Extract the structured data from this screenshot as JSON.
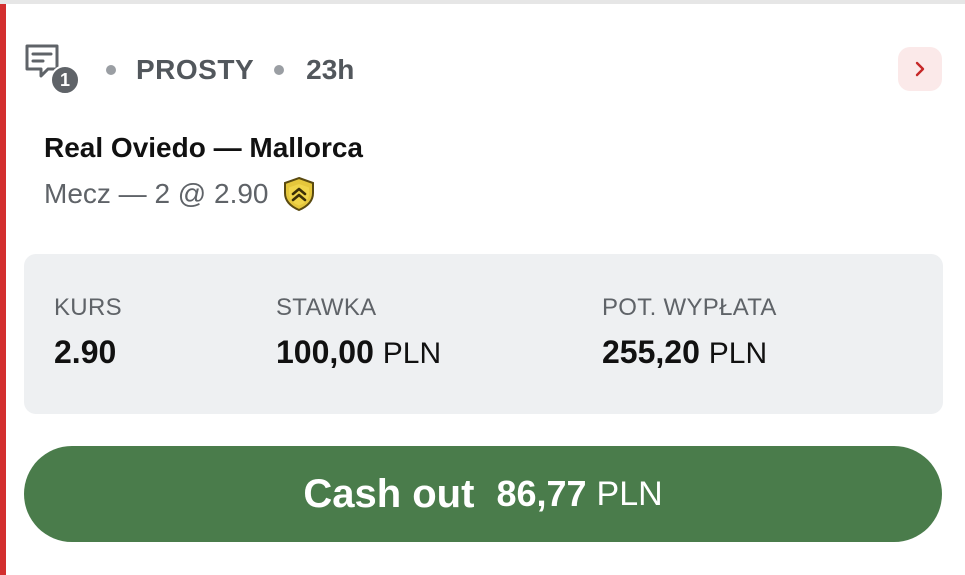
{
  "header": {
    "selection_count": "1",
    "bet_type": "PROSTY",
    "time_ago": "23h"
  },
  "match": {
    "title": "Real Oviedo — Mallorca",
    "selection": "Mecz — 2 @ 2.90"
  },
  "stats": {
    "odds_label": "KURS",
    "odds_value": "2.90",
    "stake_label": "STAWKA",
    "stake_value": "100,00",
    "stake_currency": "PLN",
    "payout_label": "POT. WYPŁATA",
    "payout_value": "255,20",
    "payout_currency": "PLN"
  },
  "cashout": {
    "label": "Cash out",
    "amount": "86,77",
    "currency": "PLN"
  },
  "colors": {
    "accent": "#d32f2f",
    "cashout_bg": "#4a7c4b",
    "boost_badge": "#e5c73c",
    "panel_bg": "#eef0f2"
  },
  "icons": {
    "ticket": "ticket-icon",
    "chevron": "chevron-right-icon",
    "boost": "boost-shield-icon"
  }
}
